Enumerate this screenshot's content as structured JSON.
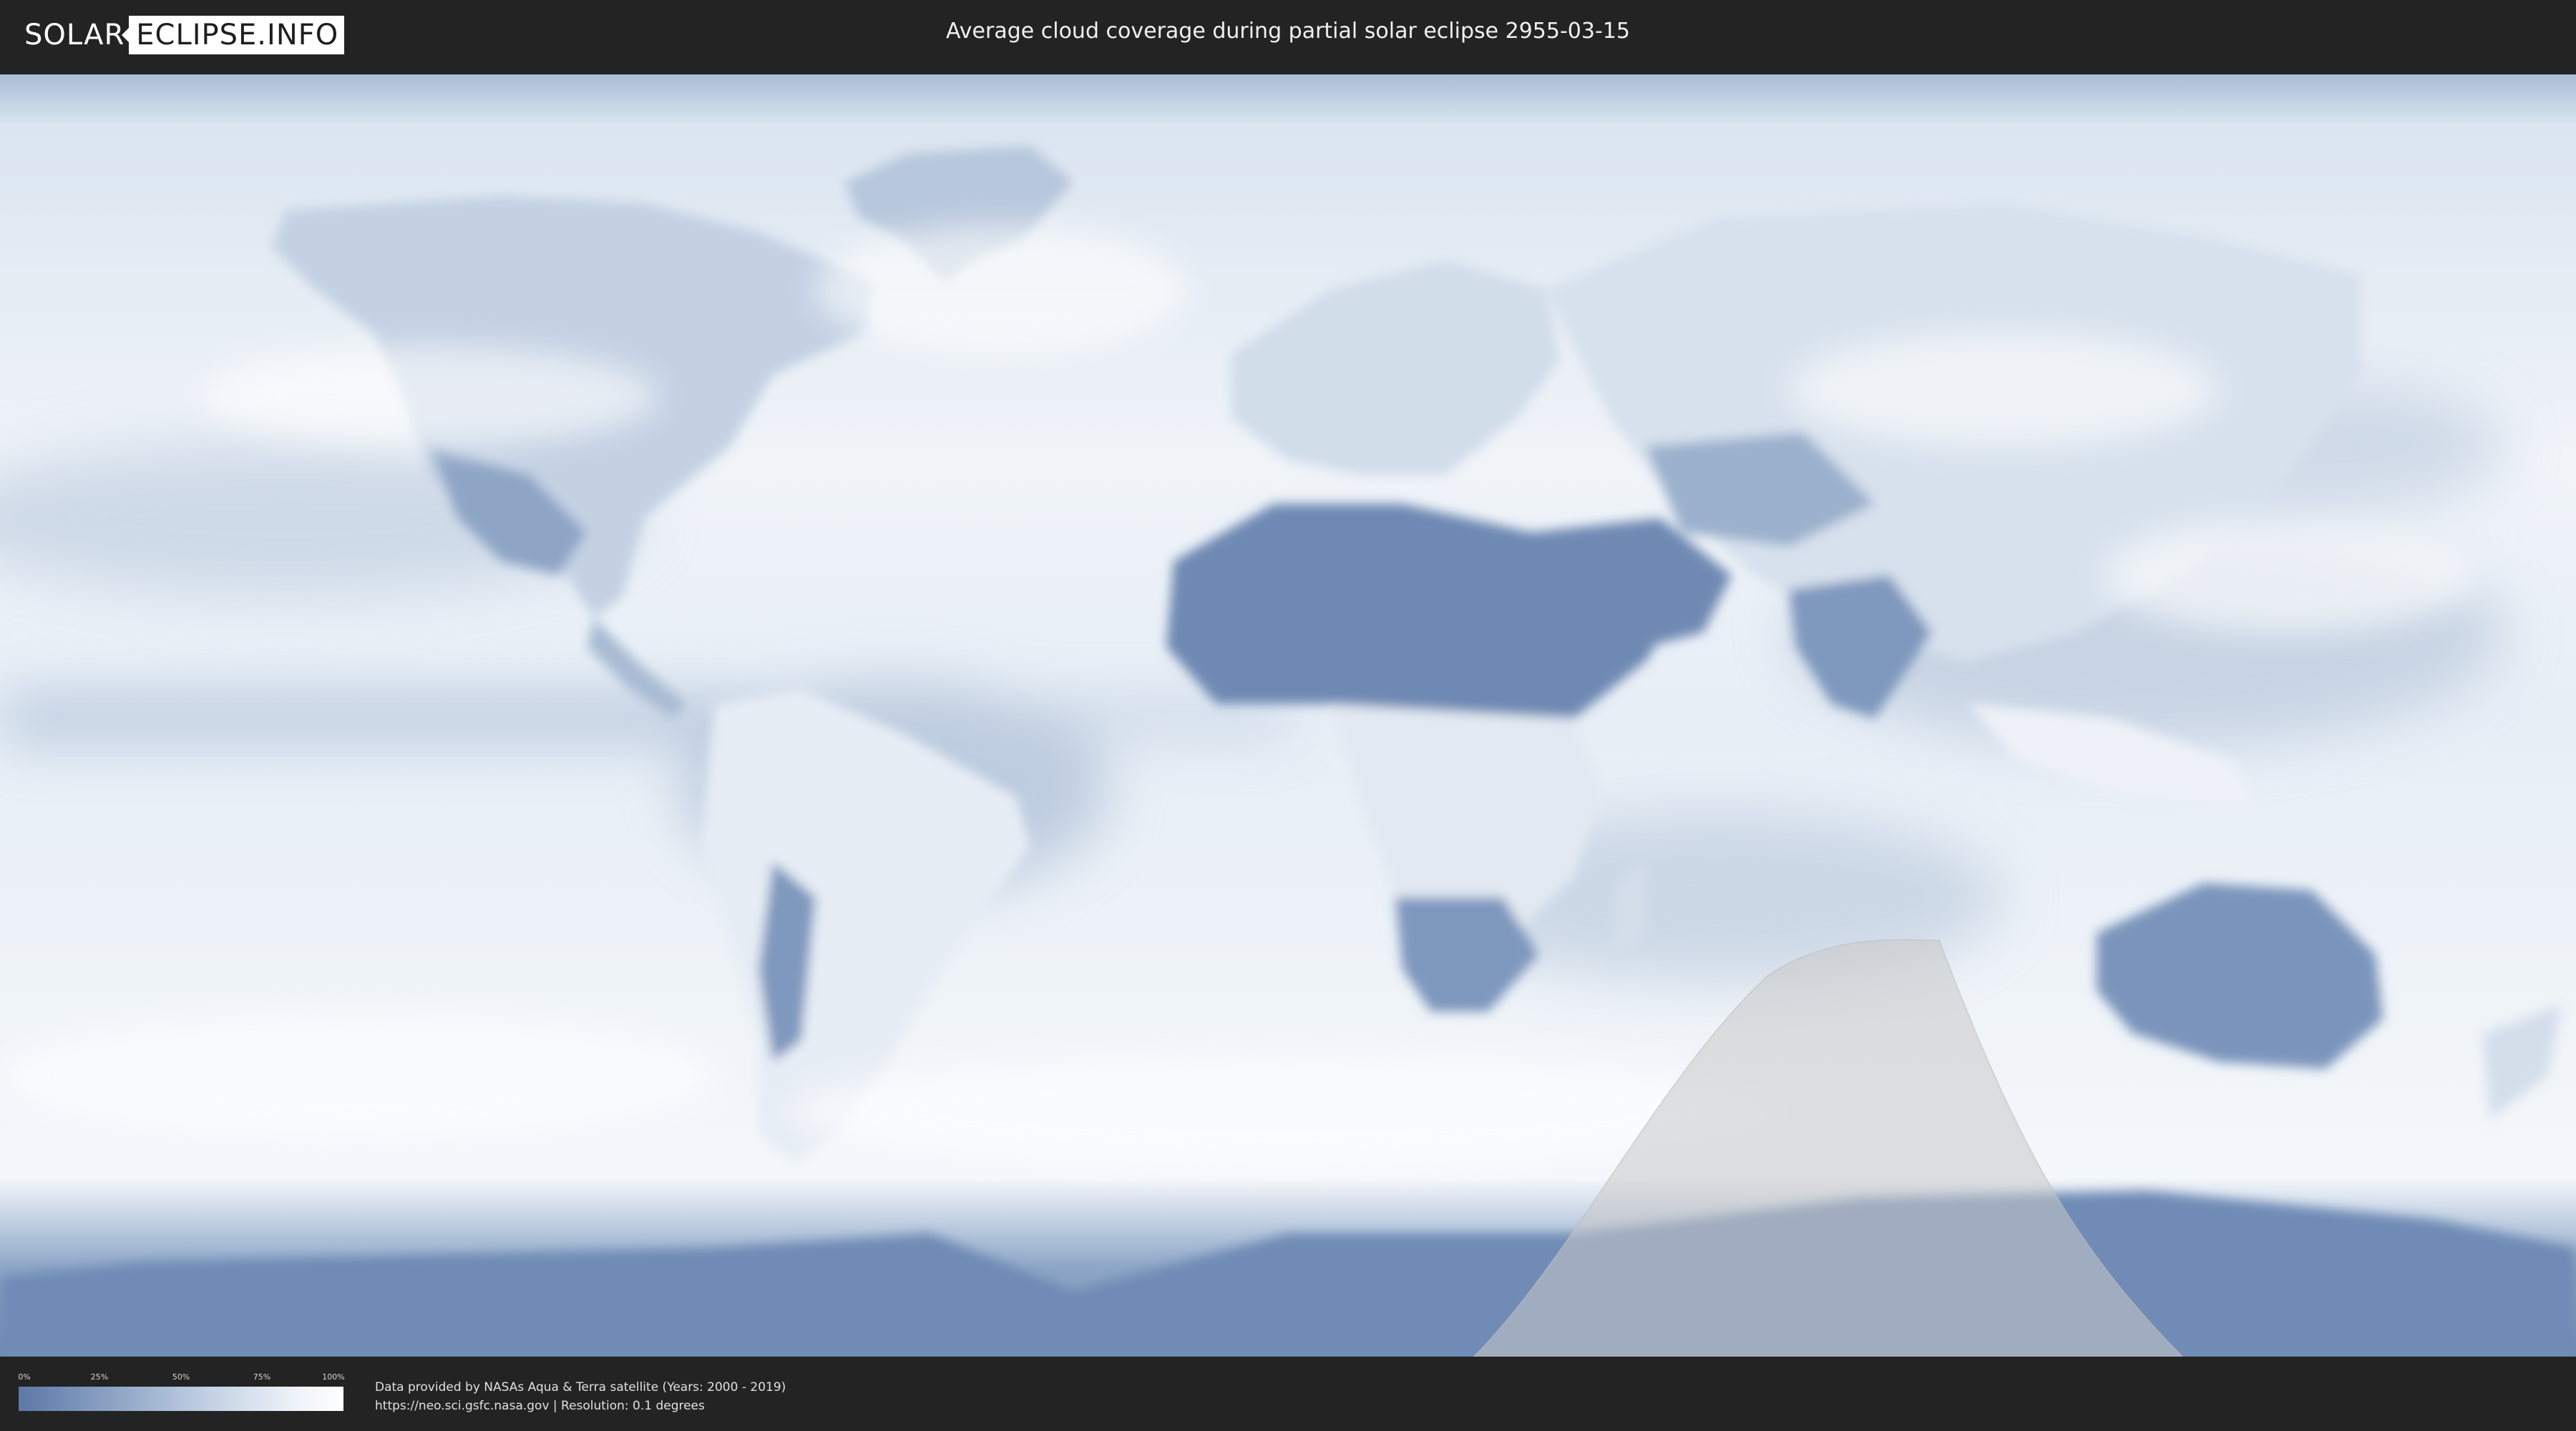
{
  "header": {
    "logo_left": "SOLAR",
    "logo_right": "ECLIPSE.INFO",
    "title": "Average cloud coverage during partial solar eclipse 2955-03-15"
  },
  "map": {
    "description_colors": {
      "clear_sky": "#5c78a6",
      "full_cloud": "#ffffff",
      "eclipse_zone": "#c8c8c8"
    },
    "eclipse_event": "partial solar eclipse",
    "eclipse_date": "2955-03-15"
  },
  "legend": {
    "ticks": [
      "0%",
      "25%",
      "50%",
      "75%",
      "100%"
    ]
  },
  "credits": {
    "line1": "Data provided by NASAs Aqua & Terra satellite (Years: 2000 - 2019)",
    "line2": "https://neo.sci.gsfc.nasa.gov | Resolution: 0.1 degrees"
  }
}
